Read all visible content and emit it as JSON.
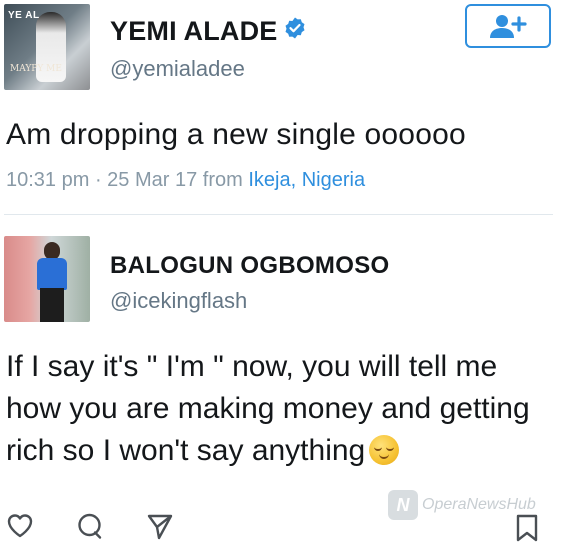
{
  "tweet": {
    "author_name": "YEMI ALADE",
    "author_handle": "@yemialadee",
    "avatar_text_top": "YE AL",
    "avatar_text_bottom": "MAYPY ME",
    "text": "Am dropping a new single oooooo",
    "time": "10:31 pm",
    "date": "25 Mar 17",
    "from_label": "from",
    "location": "Ikeja, Nigeria"
  },
  "reply": {
    "author_name": "BALOGUN OGBOMOSO",
    "author_handle": "@icekingflash",
    "text": "If I say it's \" I'm \" now, you will tell me how you are making money and getting rich so I won't say anything"
  },
  "icons": {
    "verified": "verified-badge-icon",
    "follow": "add-user-icon",
    "like": "heart-icon",
    "reply": "reply-icon",
    "share": "share-icon",
    "bookmark": "bookmark-icon",
    "emoji": "smirk-emoji-icon"
  },
  "watermark": {
    "text": "OperaNewsHub"
  },
  "colors": {
    "accent": "#2f8fde",
    "text": "#14171a",
    "secondary": "#657786",
    "meta": "#8899a6",
    "divider": "#e1e8ed"
  }
}
